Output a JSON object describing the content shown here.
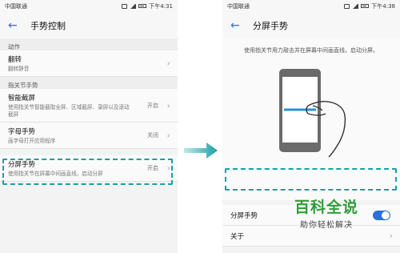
{
  "left": {
    "status": {
      "carrier": "中国联通",
      "icons": [
        "nfc-icon",
        "vibrate-icon",
        "wifi-icon",
        "signal-icon",
        "battery-icon"
      ],
      "time": "下午4:31"
    },
    "title": "手势控制",
    "sections": [
      {
        "header": "动作",
        "items": [
          {
            "title": "翻转",
            "subtitle": "翻转静音",
            "value": ""
          }
        ]
      },
      {
        "header": "指关节手势",
        "items": [
          {
            "title": "智能截屏",
            "subtitle": "使用指关节智能截取全屏、区域截屏、录屏以及滚动截屏",
            "value": "开启"
          },
          {
            "title": "字母手势",
            "subtitle": "画字母打开应用程序",
            "value": "关闭"
          },
          {
            "title": "分屏手势",
            "subtitle": "使用指关节在屏幕中间画直线，启动分屏",
            "value": "开启"
          }
        ]
      }
    ]
  },
  "right": {
    "status": {
      "carrier": "中国联通",
      "time": "下午4:38"
    },
    "title": "分屏手势",
    "description": "使用指关节用力敲击并在屏幕中间画直线，启动分屏。",
    "toggle_label": "分屏手势",
    "toggle_on": true,
    "about_label": "关于"
  },
  "watermark": {
    "big": "百科全说",
    "small": "助你轻松解决"
  },
  "colors": {
    "accent": "#2a6fdb",
    "highlight": "#1aa0a3",
    "watermark": "#2e9e3a"
  }
}
